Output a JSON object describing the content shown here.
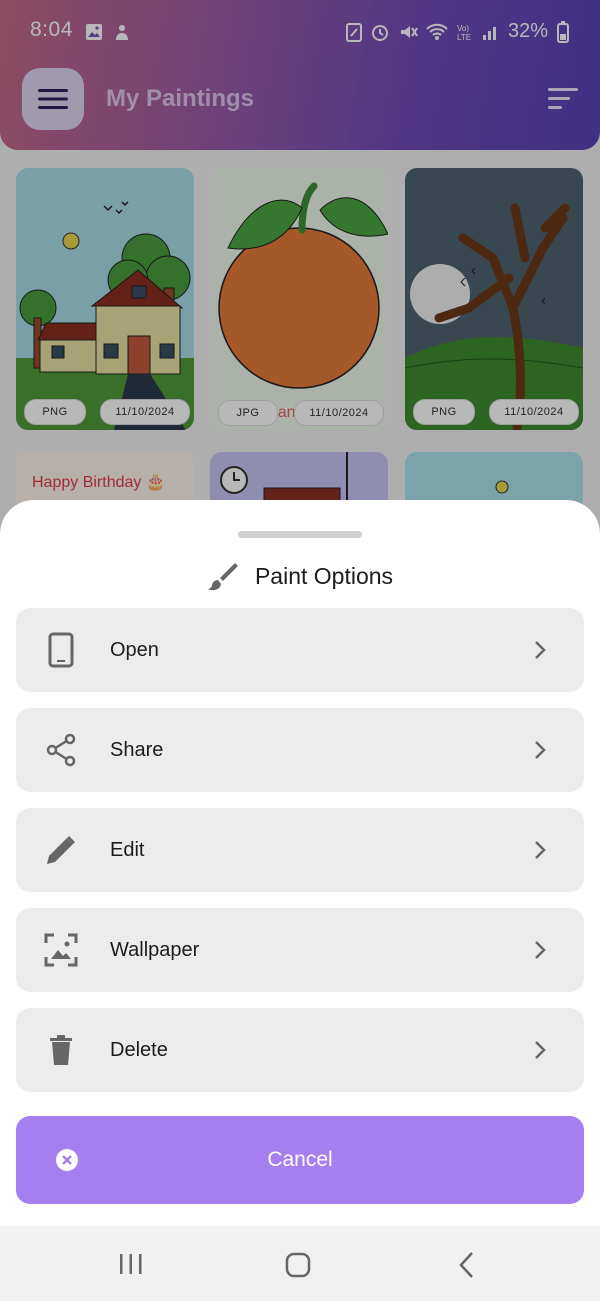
{
  "status_bar": {
    "time": "8:04",
    "battery": "32%"
  },
  "header": {
    "title": "My Paintings"
  },
  "gallery": [
    {
      "format": "PNG",
      "date": "11/10/2024"
    },
    {
      "format": "JPG",
      "date": "11/10/2024",
      "caption": "Orange"
    },
    {
      "format": "PNG",
      "date": "11/10/2024"
    },
    {
      "caption": "Happy Birthday 🎂"
    }
  ],
  "sheet": {
    "title": "Paint Options",
    "options": [
      {
        "label": "Open",
        "icon": "phone-icon"
      },
      {
        "label": "Share",
        "icon": "share-icon"
      },
      {
        "label": "Edit",
        "icon": "pencil-icon"
      },
      {
        "label": "Wallpaper",
        "icon": "wallpaper-icon"
      },
      {
        "label": "Delete",
        "icon": "trash-icon"
      }
    ],
    "cancel_label": "Cancel"
  },
  "colors": {
    "accent": "#a57ef0",
    "header_start": "#c46b86",
    "header_end": "#5a44b8"
  }
}
